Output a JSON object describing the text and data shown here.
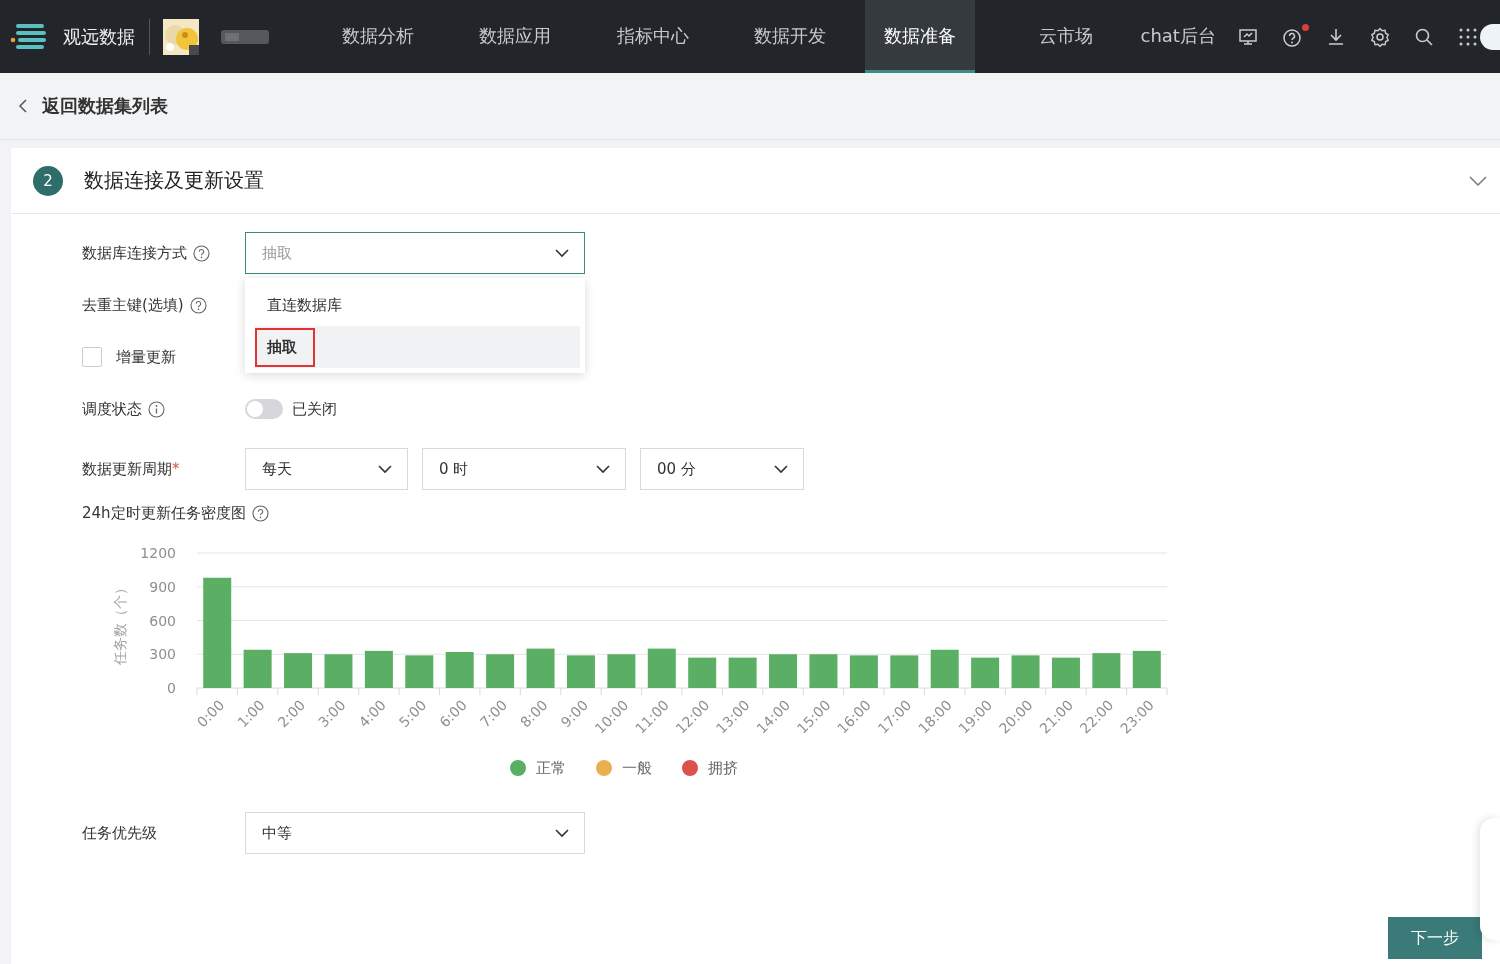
{
  "nav": {
    "brand": "观远数据",
    "items": [
      {
        "label": "数据分析",
        "selected": false
      },
      {
        "label": "数据应用",
        "selected": false
      },
      {
        "label": "指标中心",
        "selected": false
      },
      {
        "label": "数据开发",
        "selected": false
      },
      {
        "label": "数据准备",
        "selected": true
      },
      {
        "label": "云市场",
        "selected": false
      },
      {
        "label": "chat后台",
        "selected": false
      }
    ],
    "icons": [
      {
        "kind": "monitor",
        "notification": false
      },
      {
        "kind": "help",
        "notification": true
      },
      {
        "kind": "download",
        "notification": false
      },
      {
        "kind": "settings",
        "notification": false
      },
      {
        "kind": "search",
        "notification": false
      },
      {
        "kind": "apps",
        "notification": false
      }
    ]
  },
  "back": {
    "label": "返回数据集列表"
  },
  "section": {
    "step": "2",
    "title": "数据连接及更新设置"
  },
  "fields": [
    {
      "kind": "select",
      "label": "数据库连接方式",
      "hint": {
        "kind": "question"
      },
      "value": "抽取",
      "open": true,
      "options": [
        {
          "label": "直连数据库",
          "selected": false,
          "marked": false
        },
        {
          "label": "抽取",
          "selected": true,
          "marked": true
        }
      ]
    },
    {
      "kind": "label",
      "label": "去重主键(选填)",
      "hint": {
        "kind": "question"
      }
    },
    {
      "kind": "checkbox",
      "label": "增量更新",
      "checked": false
    },
    {
      "kind": "switch",
      "label": "调度状态",
      "hint": {
        "kind": "info"
      },
      "on": false,
      "state_text": "已关闭"
    },
    {
      "kind": "period",
      "label": "数据更新周期",
      "required_mark": "*",
      "selects": [
        "每天",
        "0 时",
        "00 分"
      ]
    },
    {
      "kind": "chart",
      "label": "24h定时更新任务密度图",
      "hint": {
        "kind": "question"
      },
      "chart_data": {
        "type": "bar",
        "ylabel": "任务数（个）",
        "grid": true,
        "categories": [
          "0:00",
          "1:00",
          "2:00",
          "3:00",
          "4:00",
          "5:00",
          "6:00",
          "7:00",
          "8:00",
          "9:00",
          "10:00",
          "11:00",
          "12:00",
          "13:00",
          "14:00",
          "15:00",
          "16:00",
          "17:00",
          "18:00",
          "19:00",
          "20:00",
          "21:00",
          "22:00",
          "23:00"
        ],
        "ylim": [
          0,
          1200
        ],
        "yticks": [
          0,
          300,
          600,
          900,
          1200
        ],
        "series": [
          {
            "name": "正常",
            "color": "#5aaf64",
            "values": [
              980,
              340,
              310,
              300,
              330,
              290,
              320,
              300,
              350,
              290,
              300,
              350,
              270,
              270,
              300,
              300,
              290,
              290,
              340,
              270,
              290,
              270,
              310,
              330
            ]
          },
          {
            "name": "一般",
            "color": "#e8b04f",
            "values": [
              null,
              null,
              null,
              null,
              null,
              null,
              null,
              null,
              null,
              null,
              null,
              null,
              null,
              null,
              null,
              null,
              null,
              null,
              null,
              null,
              null,
              null,
              null,
              null
            ]
          },
          {
            "name": "拥挤",
            "color": "#d9534a",
            "values": [
              null,
              null,
              null,
              null,
              null,
              null,
              null,
              null,
              null,
              null,
              null,
              null,
              null,
              null,
              null,
              null,
              null,
              null,
              null,
              null,
              null,
              null,
              null,
              null
            ]
          }
        ]
      }
    },
    {
      "kind": "select",
      "label": "任务优先级",
      "value": "中等",
      "open": false
    }
  ],
  "footer": {
    "next_button": "下一步"
  }
}
